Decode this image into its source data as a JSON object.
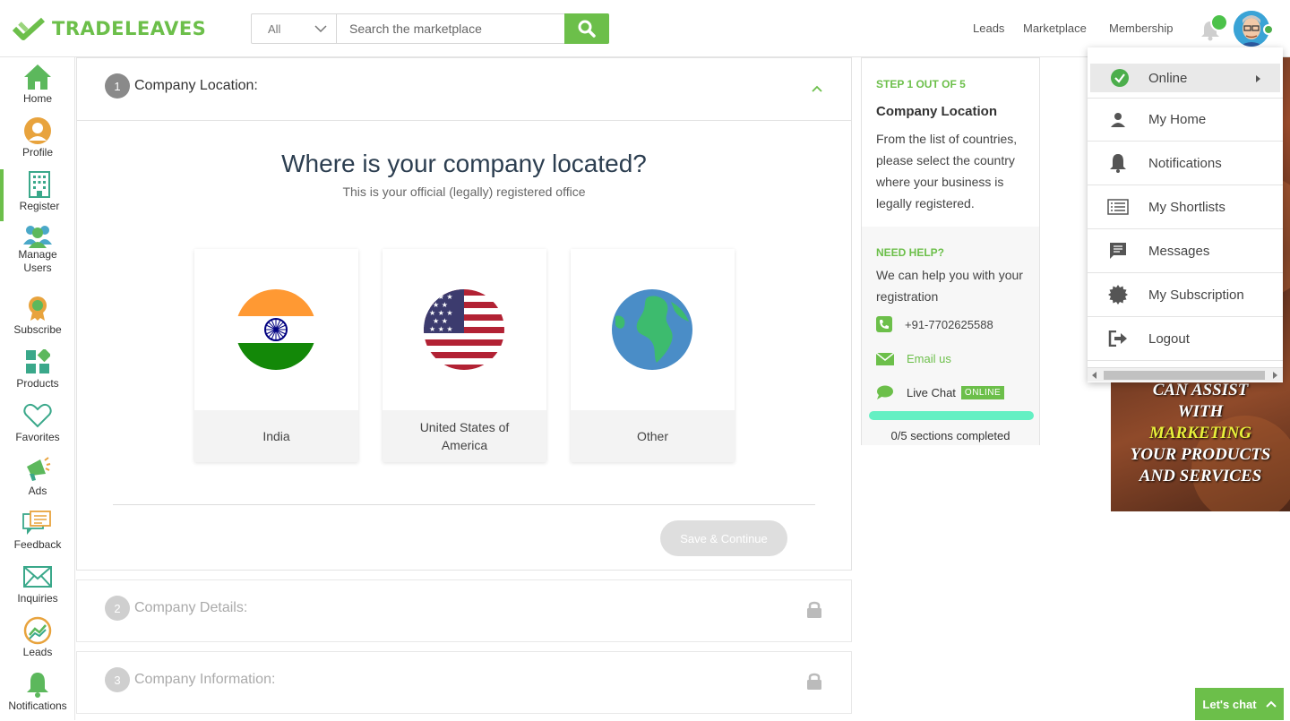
{
  "brand": {
    "name": "TRADELEAVES"
  },
  "search": {
    "category": "All",
    "placeholder": "Search the marketplace"
  },
  "topnav": {
    "leads": "Leads",
    "marketplace": "Marketplace",
    "membership": "Membership"
  },
  "sidebar": {
    "items": [
      {
        "label": "Home",
        "icon": "home-icon"
      },
      {
        "label": "Profile",
        "icon": "profile-icon"
      },
      {
        "label": "Register",
        "icon": "building-icon"
      },
      {
        "label": "Manage Users",
        "icon": "users-icon"
      },
      {
        "label": "Subscribe",
        "icon": "badge-icon"
      },
      {
        "label": "Products",
        "icon": "products-icon"
      },
      {
        "label": "Favorites",
        "icon": "heart-icon"
      },
      {
        "label": "Ads",
        "icon": "megaphone-icon"
      },
      {
        "label": "Feedback",
        "icon": "feedback-icon"
      },
      {
        "label": "Inquiries",
        "icon": "envelope-icon"
      },
      {
        "label": "Leads",
        "icon": "chart-icon"
      },
      {
        "label": "Notifications",
        "icon": "bell-icon"
      }
    ],
    "active": "Register"
  },
  "steps": {
    "step1": {
      "num": "1",
      "title": "Company Location:"
    },
    "step2": {
      "num": "2",
      "title": "Company Details:"
    },
    "step3": {
      "num": "3",
      "title": "Company Information:"
    }
  },
  "location": {
    "heading": "Where is your company located?",
    "subheading": "This is your official (legally) registered office",
    "countries": [
      {
        "name": "India"
      },
      {
        "name": "United States of America"
      },
      {
        "name": "Other"
      }
    ],
    "save_label": "Save & Continue"
  },
  "info": {
    "step_of": "STEP 1 OUT OF 5",
    "title": "Company Location",
    "description": "From the list of countries, please select the country where your business is legally registered.",
    "need_help": "NEED HELP?",
    "help_text": "We can help you with your registration",
    "phone": "+91-7702625588",
    "email": "Email us",
    "chat": "Live Chat",
    "chat_status": "ONLINE",
    "progress_text": "0/5 sections completed",
    "progress": 0
  },
  "ad": {
    "line1": "CAN ASSIST",
    "line2": "WITH",
    "line3": "MARKETING",
    "line4": "YOUR PRODUCTS",
    "line5": "AND SERVICES"
  },
  "user_menu": {
    "status": "Online",
    "items": [
      {
        "label": "My Home",
        "icon": "person-icon"
      },
      {
        "label": "Notifications",
        "icon": "bell-icon"
      },
      {
        "label": "My Shortlists",
        "icon": "list-icon"
      },
      {
        "label": "Messages",
        "icon": "message-icon"
      },
      {
        "label": "My Subscription",
        "icon": "gear-badge-icon"
      },
      {
        "label": "Logout",
        "icon": "logout-icon"
      }
    ]
  },
  "chat_widget": {
    "label": "Let's chat"
  },
  "colors": {
    "brand_green": "#6cbf4a",
    "progress": "#64f0c3",
    "ad_highlight": "#e8ef3a"
  }
}
